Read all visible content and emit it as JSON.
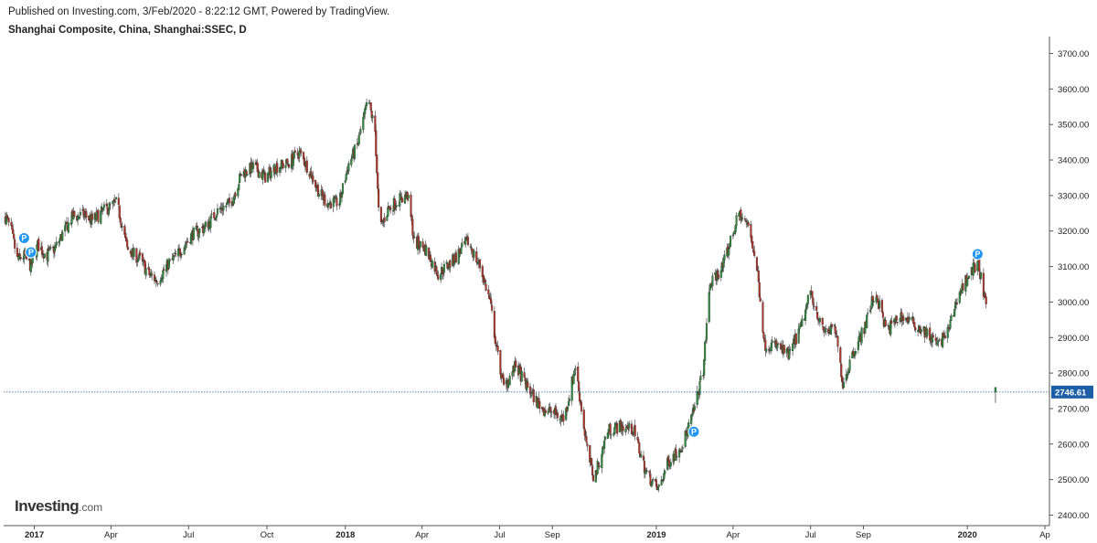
{
  "header": {
    "published": "Published on Investing.com, 3/Feb/2020 - 8:22:12 GMT, Powered by TradingView.",
    "symbol": "Shanghai Composite, China, Shanghai:SSEC, D"
  },
  "logo": {
    "main": "Investing",
    "suffix": ".com"
  },
  "colors": {
    "up": "#2e8b3d",
    "down": "#b0342a",
    "wick": "#333333",
    "marker": "#2196f3",
    "last_line": "#1c5fa6"
  },
  "chart_data": {
    "type": "candlestick",
    "x_ticks": [
      {
        "label": "2017",
        "date": "2017-01-01",
        "year": true
      },
      {
        "label": "Apr",
        "date": "2017-04-01",
        "year": false
      },
      {
        "label": "Jul",
        "date": "2017-07-01",
        "year": false
      },
      {
        "label": "Oct",
        "date": "2017-10-01",
        "year": false
      },
      {
        "label": "2018",
        "date": "2018-01-01",
        "year": true
      },
      {
        "label": "Apr",
        "date": "2018-04-01",
        "year": false
      },
      {
        "label": "Jul",
        "date": "2018-07-01",
        "year": false
      },
      {
        "label": "Sep",
        "date": "2018-09-01",
        "year": false
      },
      {
        "label": "2019",
        "date": "2019-01-01",
        "year": true
      },
      {
        "label": "Apr",
        "date": "2019-04-01",
        "year": false
      },
      {
        "label": "Jul",
        "date": "2019-07-01",
        "year": false
      },
      {
        "label": "Sep",
        "date": "2019-09-01",
        "year": false
      },
      {
        "label": "2020",
        "date": "2020-01-01",
        "year": true
      },
      {
        "label": "Ap",
        "date": "2020-04-01",
        "year": false
      }
    ],
    "y_ticks": [
      "2400.00",
      "2500.00",
      "2600.00",
      "2700.00",
      "2800.00",
      "2900.00",
      "3000.00",
      "3100.00",
      "3200.00",
      "3300.00",
      "3400.00",
      "3500.00",
      "3600.00",
      "3700.00"
    ],
    "ylim": [
      2400,
      3700
    ],
    "last_price": 2746.61,
    "last_price_label": "2746.61",
    "markers": [
      {
        "label": "P",
        "date": "2016-12-20",
        "value": 3180
      },
      {
        "label": "P",
        "date": "2016-12-28",
        "value": 3140
      },
      {
        "label": "P",
        "date": "2019-02-14",
        "value": 2635
      },
      {
        "label": "P",
        "date": "2020-01-13",
        "value": 3135
      }
    ],
    "path": [
      [
        "2016-11-28",
        3240
      ],
      [
        "2016-12-05",
        3200
      ],
      [
        "2016-12-12",
        3120
      ],
      [
        "2016-12-20",
        3130
      ],
      [
        "2016-12-28",
        3100
      ],
      [
        "2017-01-05",
        3160
      ],
      [
        "2017-01-15",
        3130
      ],
      [
        "2017-01-25",
        3150
      ],
      [
        "2017-02-05",
        3200
      ],
      [
        "2017-02-15",
        3240
      ],
      [
        "2017-02-28",
        3245
      ],
      [
        "2017-03-10",
        3230
      ],
      [
        "2017-03-25",
        3260
      ],
      [
        "2017-04-08",
        3280
      ],
      [
        "2017-04-20",
        3150
      ],
      [
        "2017-05-05",
        3120
      ],
      [
        "2017-05-15",
        3080
      ],
      [
        "2017-05-25",
        3060
      ],
      [
        "2017-06-05",
        3100
      ],
      [
        "2017-06-20",
        3140
      ],
      [
        "2017-07-05",
        3190
      ],
      [
        "2017-07-20",
        3210
      ],
      [
        "2017-08-05",
        3260
      ],
      [
        "2017-08-20",
        3280
      ],
      [
        "2017-09-01",
        3360
      ],
      [
        "2017-09-15",
        3380
      ],
      [
        "2017-09-30",
        3350
      ],
      [
        "2017-10-10",
        3380
      ],
      [
        "2017-10-25",
        3390
      ],
      [
        "2017-11-08",
        3420
      ],
      [
        "2017-11-20",
        3370
      ],
      [
        "2017-12-01",
        3310
      ],
      [
        "2017-12-10",
        3280
      ],
      [
        "2017-12-25",
        3280
      ],
      [
        "2018-01-05",
        3390
      ],
      [
        "2018-01-15",
        3440
      ],
      [
        "2018-01-28",
        3570
      ],
      [
        "2018-02-05",
        3480
      ],
      [
        "2018-02-10",
        3200
      ],
      [
        "2018-02-20",
        3260
      ],
      [
        "2018-03-05",
        3290
      ],
      [
        "2018-03-15",
        3300
      ],
      [
        "2018-03-23",
        3170
      ],
      [
        "2018-04-05",
        3150
      ],
      [
        "2018-04-20",
        3080
      ],
      [
        "2018-05-05",
        3110
      ],
      [
        "2018-05-25",
        3170
      ],
      [
        "2018-06-08",
        3100
      ],
      [
        "2018-06-20",
        3000
      ],
      [
        "2018-06-28",
        2860
      ],
      [
        "2018-07-06",
        2760
      ],
      [
        "2018-07-20",
        2820
      ],
      [
        "2018-08-05",
        2750
      ],
      [
        "2018-08-20",
        2700
      ],
      [
        "2018-09-01",
        2690
      ],
      [
        "2018-09-15",
        2670
      ],
      [
        "2018-09-28",
        2820
      ],
      [
        "2018-10-12",
        2580
      ],
      [
        "2018-10-20",
        2500
      ],
      [
        "2018-11-05",
        2640
      ],
      [
        "2018-11-20",
        2650
      ],
      [
        "2018-12-05",
        2640
      ],
      [
        "2018-12-20",
        2520
      ],
      [
        "2019-01-03",
        2470
      ],
      [
        "2019-01-15",
        2550
      ],
      [
        "2019-02-01",
        2600
      ],
      [
        "2019-02-15",
        2700
      ],
      [
        "2019-02-25",
        2810
      ],
      [
        "2019-03-05",
        3050
      ],
      [
        "2019-03-20",
        3100
      ],
      [
        "2019-04-08",
        3250
      ],
      [
        "2019-04-20",
        3210
      ],
      [
        "2019-04-30",
        3080
      ],
      [
        "2019-05-08",
        2880
      ],
      [
        "2019-05-20",
        2880
      ],
      [
        "2019-06-05",
        2850
      ],
      [
        "2019-06-20",
        2930
      ],
      [
        "2019-07-01",
        3030
      ],
      [
        "2019-07-15",
        2920
      ],
      [
        "2019-07-30",
        2920
      ],
      [
        "2019-08-08",
        2770
      ],
      [
        "2019-08-20",
        2860
      ],
      [
        "2019-09-01",
        2920
      ],
      [
        "2019-09-15",
        3030
      ],
      [
        "2019-09-28",
        2920
      ],
      [
        "2019-10-15",
        2960
      ],
      [
        "2019-10-30",
        2940
      ],
      [
        "2019-11-15",
        2910
      ],
      [
        "2019-11-28",
        2880
      ],
      [
        "2019-12-10",
        2920
      ],
      [
        "2019-12-20",
        3010
      ],
      [
        "2020-01-03",
        3080
      ],
      [
        "2020-01-14",
        3110
      ],
      [
        "2020-01-23",
        2980
      ]
    ],
    "gap_candle": {
      "date": "2020-02-03",
      "open": 2760,
      "high": 2760,
      "low": 2716,
      "close": 2746.61
    }
  }
}
